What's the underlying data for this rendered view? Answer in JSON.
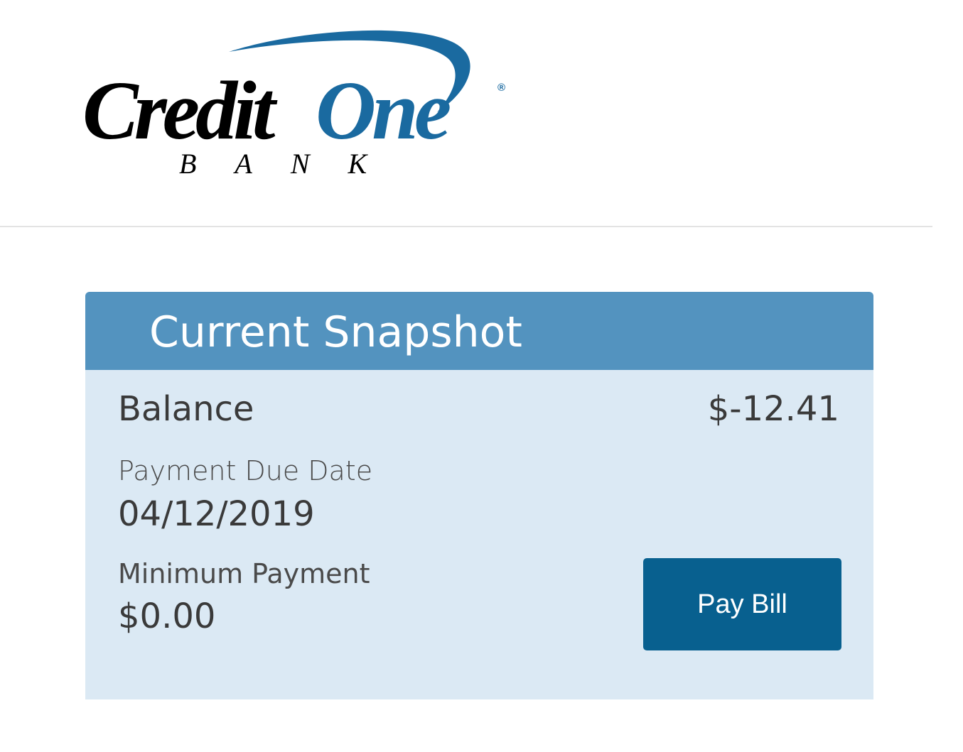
{
  "logo": {
    "brand_word_1": "Credit",
    "brand_word_2": "One",
    "brand_sub": "BANK",
    "registered_mark": "®",
    "colors": {
      "black": "#000000",
      "blue": "#1a6aa0"
    }
  },
  "snapshot": {
    "title": "Current Snapshot",
    "balance_label": "Balance",
    "balance_value": "$-12.41",
    "due_date_label": "Payment Due Date",
    "due_date_value": "04/12/2019",
    "min_payment_label": "Minimum Payment",
    "min_payment_value": "$0.00",
    "pay_button_label": "Pay Bill"
  },
  "colors": {
    "header_bg": "#5393bf",
    "card_bg": "#dbe9f4",
    "button_bg": "#08608f",
    "text": "#3a3a3a"
  }
}
